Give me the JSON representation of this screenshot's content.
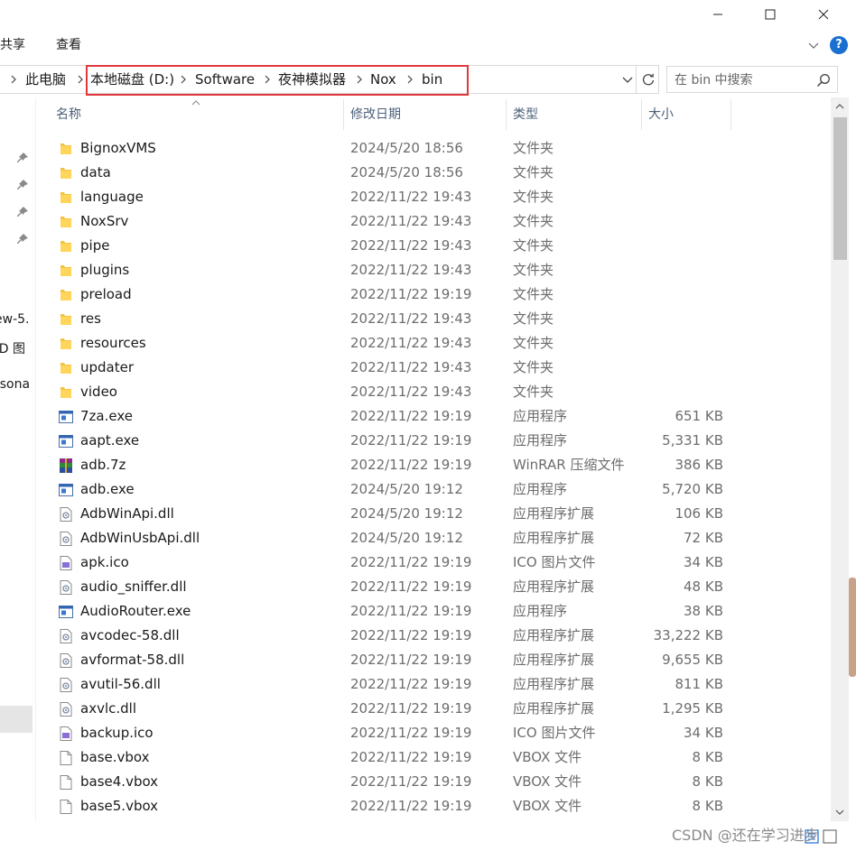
{
  "ribbon": {
    "tab_share": "共享",
    "tab_view": "查看",
    "help_label": "?"
  },
  "address": {
    "segments": [
      "此电脑",
      "本地磁盘 (D:)",
      "Software",
      "夜神模拟器",
      "Nox",
      "bin"
    ]
  },
  "search": {
    "placeholder": "在 bin 中搜索"
  },
  "nav": {
    "partial_items": [
      "ew-5.",
      "/D 图",
      "rsona"
    ]
  },
  "columns": {
    "name": "名称",
    "date": "修改日期",
    "type": "类型",
    "size": "大小"
  },
  "files": [
    {
      "name": "BignoxVMS",
      "date": "2024/5/20 18:56",
      "type": "文件夹",
      "size": "",
      "icon": "folder-icon"
    },
    {
      "name": "data",
      "date": "2024/5/20 18:56",
      "type": "文件夹",
      "size": "",
      "icon": "folder-icon"
    },
    {
      "name": "language",
      "date": "2022/11/22 19:43",
      "type": "文件夹",
      "size": "",
      "icon": "folder-icon"
    },
    {
      "name": "NoxSrv",
      "date": "2022/11/22 19:43",
      "type": "文件夹",
      "size": "",
      "icon": "folder-icon"
    },
    {
      "name": "pipe",
      "date": "2022/11/22 19:43",
      "type": "文件夹",
      "size": "",
      "icon": "folder-icon"
    },
    {
      "name": "plugins",
      "date": "2022/11/22 19:43",
      "type": "文件夹",
      "size": "",
      "icon": "folder-icon"
    },
    {
      "name": "preload",
      "date": "2022/11/22 19:19",
      "type": "文件夹",
      "size": "",
      "icon": "folder-icon"
    },
    {
      "name": "res",
      "date": "2022/11/22 19:43",
      "type": "文件夹",
      "size": "",
      "icon": "folder-icon"
    },
    {
      "name": "resources",
      "date": "2022/11/22 19:43",
      "type": "文件夹",
      "size": "",
      "icon": "folder-icon"
    },
    {
      "name": "updater",
      "date": "2022/11/22 19:43",
      "type": "文件夹",
      "size": "",
      "icon": "folder-icon"
    },
    {
      "name": "video",
      "date": "2022/11/22 19:43",
      "type": "文件夹",
      "size": "",
      "icon": "folder-icon"
    },
    {
      "name": "7za.exe",
      "date": "2022/11/22 19:19",
      "type": "应用程序",
      "size": "651 KB",
      "icon": "exe-icon"
    },
    {
      "name": "aapt.exe",
      "date": "2022/11/22 19:19",
      "type": "应用程序",
      "size": "5,331 KB",
      "icon": "exe-icon"
    },
    {
      "name": "adb.7z",
      "date": "2022/11/22 19:19",
      "type": "WinRAR 压缩文件",
      "size": "386 KB",
      "icon": "winrar-icon"
    },
    {
      "name": "adb.exe",
      "date": "2024/5/20 19:12",
      "type": "应用程序",
      "size": "5,720 KB",
      "icon": "exe-icon"
    },
    {
      "name": "AdbWinApi.dll",
      "date": "2024/5/20 19:12",
      "type": "应用程序扩展",
      "size": "106 KB",
      "icon": "dll-icon"
    },
    {
      "name": "AdbWinUsbApi.dll",
      "date": "2024/5/20 19:12",
      "type": "应用程序扩展",
      "size": "72 KB",
      "icon": "dll-icon"
    },
    {
      "name": "apk.ico",
      "date": "2022/11/22 19:19",
      "type": "ICO 图片文件",
      "size": "34 KB",
      "icon": "ico-file-icon"
    },
    {
      "name": "audio_sniffer.dll",
      "date": "2022/11/22 19:19",
      "type": "应用程序扩展",
      "size": "48 KB",
      "icon": "dll-icon"
    },
    {
      "name": "AudioRouter.exe",
      "date": "2022/11/22 19:19",
      "type": "应用程序",
      "size": "38 KB",
      "icon": "exe-icon"
    },
    {
      "name": "avcodec-58.dll",
      "date": "2022/11/22 19:19",
      "type": "应用程序扩展",
      "size": "33,222 KB",
      "icon": "dll-icon"
    },
    {
      "name": "avformat-58.dll",
      "date": "2022/11/22 19:19",
      "type": "应用程序扩展",
      "size": "9,655 KB",
      "icon": "dll-icon"
    },
    {
      "name": "avutil-56.dll",
      "date": "2022/11/22 19:19",
      "type": "应用程序扩展",
      "size": "811 KB",
      "icon": "dll-icon"
    },
    {
      "name": "axvlc.dll",
      "date": "2022/11/22 19:19",
      "type": "应用程序扩展",
      "size": "1,295 KB",
      "icon": "dll-icon"
    },
    {
      "name": "backup.ico",
      "date": "2022/11/22 19:19",
      "type": "ICO 图片文件",
      "size": "34 KB",
      "icon": "ico-file-icon"
    },
    {
      "name": "base.vbox",
      "date": "2022/11/22 19:19",
      "type": "VBOX 文件",
      "size": "8 KB",
      "icon": "blank-file-icon"
    },
    {
      "name": "base4.vbox",
      "date": "2022/11/22 19:19",
      "type": "VBOX 文件",
      "size": "8 KB",
      "icon": "blank-file-icon"
    },
    {
      "name": "base5.vbox",
      "date": "2022/11/22 19:19",
      "type": "VBOX 文件",
      "size": "8 KB",
      "icon": "blank-file-icon"
    }
  ],
  "watermark": "CSDN @还在学习进步",
  "colors": {
    "folder": "#f5c342",
    "highlight_border": "#e0383c",
    "header_text": "#4c607a",
    "help": "#1a6fd1"
  }
}
